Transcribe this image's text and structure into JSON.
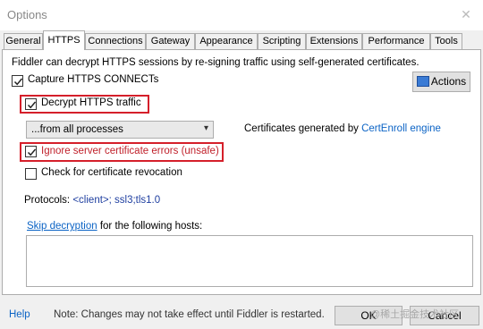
{
  "window": {
    "title": "Options"
  },
  "tabs": [
    "General",
    "HTTPS",
    "Connections",
    "Gateway",
    "Appearance",
    "Scripting",
    "Extensions",
    "Performance",
    "Tools"
  ],
  "https": {
    "description": "Fiddler can decrypt HTTPS sessions by re-signing traffic using self-generated certificates.",
    "capture_connects": {
      "label": "Capture HTTPS CONNECTs",
      "checked": true
    },
    "actions_label": "Actions",
    "decrypt_traffic": {
      "label": "Decrypt HTTPS traffic",
      "checked": true
    },
    "process_filter": "...from all processes",
    "cert_generated_prefix": "Certificates generated by",
    "cert_engine_link": "CertEnroll engine",
    "ignore_errors": {
      "label": "Ignore server certificate errors (unsafe)",
      "checked": true
    },
    "check_revocation": {
      "label": "Check for certificate revocation",
      "checked": false
    },
    "protocols_label": "Protocols:",
    "protocols_value": "<client>; ssl3;tls1.0",
    "skip_decryption_link": "Skip decryption",
    "skip_decryption_suffix": "for the following hosts:",
    "hosts_value": ""
  },
  "footer": {
    "help": "Help",
    "note": "Note: Changes may not take effect until Fiddler is restarted.",
    "ok": "OK",
    "cancel": "Cancel",
    "watermark": "@稀土掘金技术社区"
  },
  "colors": {
    "highlight": "#d51f2a",
    "link": "#0b63c5"
  }
}
